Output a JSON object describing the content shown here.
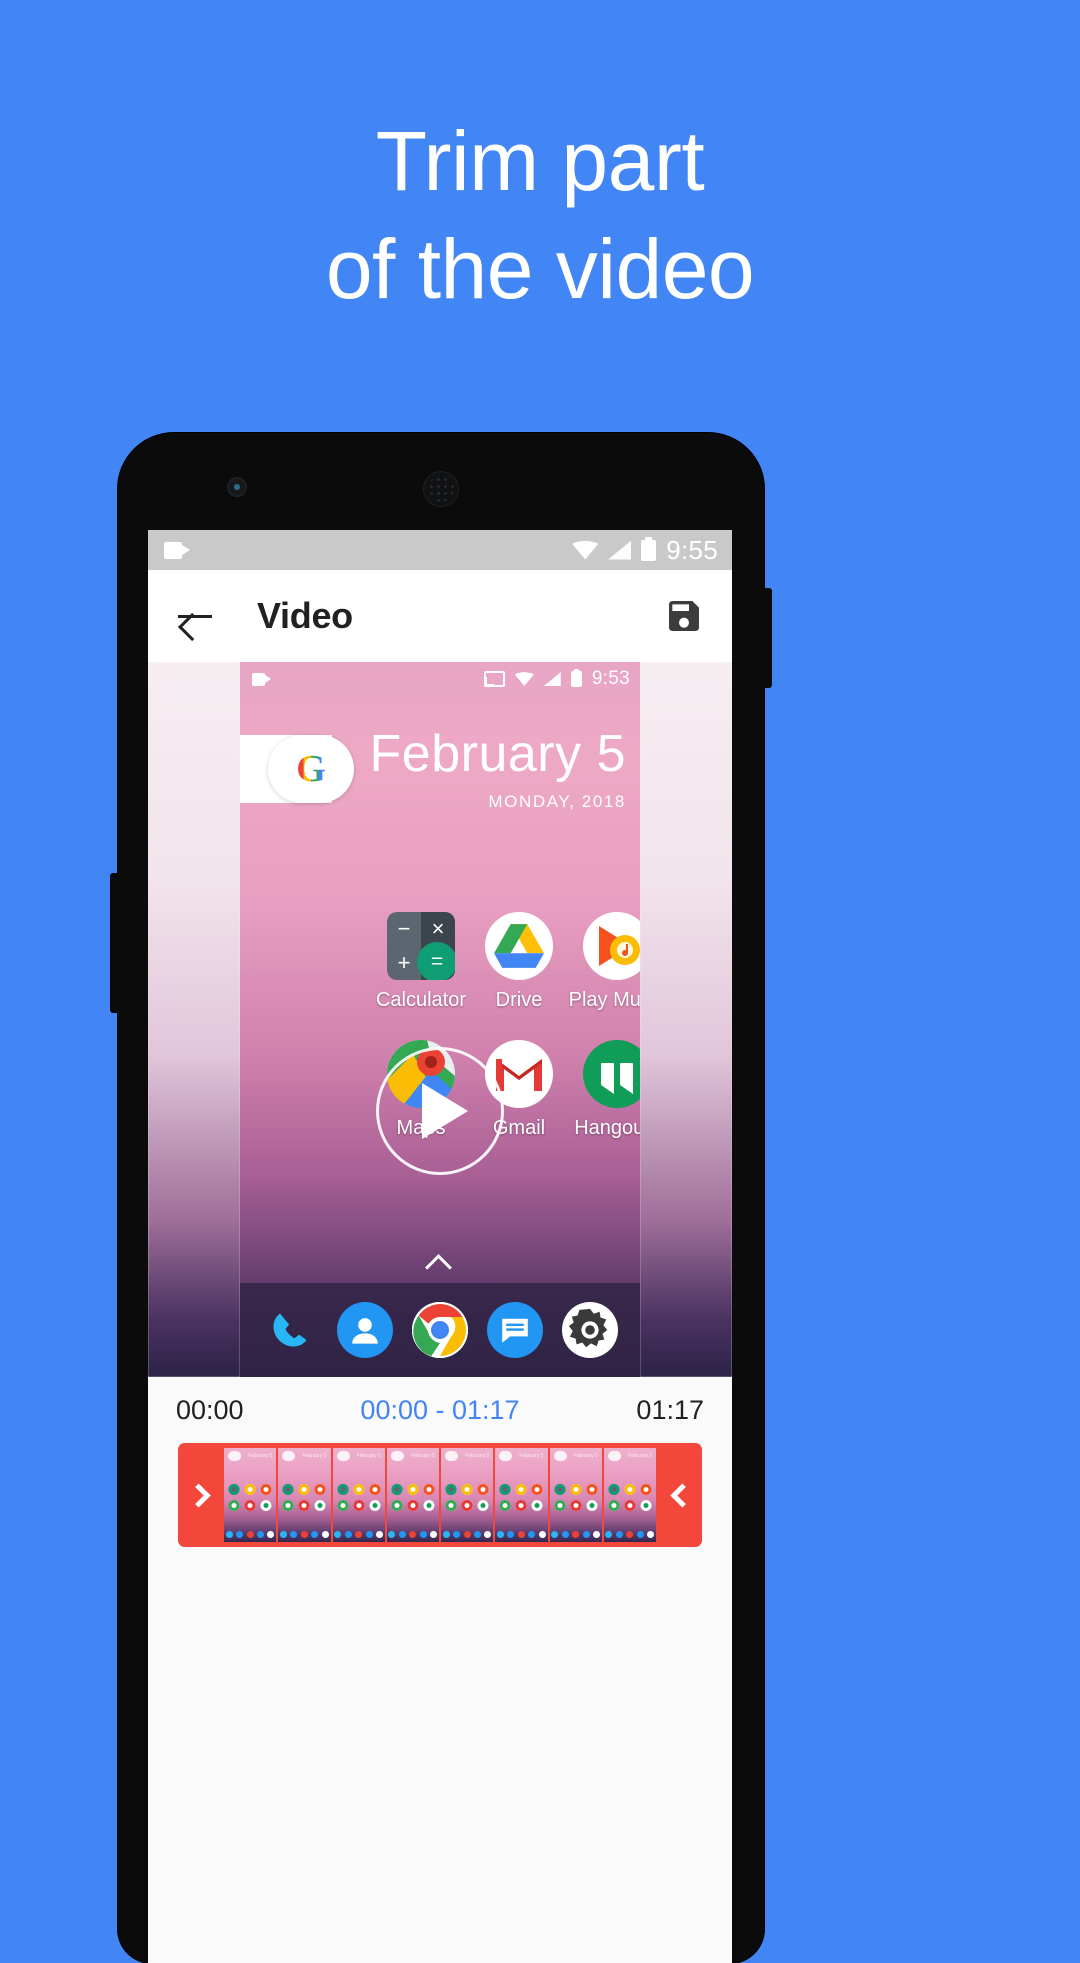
{
  "headline": {
    "line1": "Trim part",
    "line2": "of the video"
  },
  "theme": {
    "background": "#4285f4",
    "accent": "#4285f4",
    "trim_red": "#f4473b"
  },
  "status_bar": {
    "icons": [
      "videocam-icon",
      "wifi-icon",
      "signal-icon",
      "battery-icon"
    ],
    "time": "9:55"
  },
  "app_bar": {
    "back_label": "back-arrow-icon",
    "title": "Video",
    "save_label": "save-icon"
  },
  "video": {
    "inner_status": {
      "time": "9:53",
      "icons": [
        "videocam-icon",
        "cast-icon",
        "wifi-icon",
        "signal-icon",
        "battery-icon"
      ]
    },
    "widget": {
      "logo": "G"
    },
    "date": {
      "day": "February 5",
      "sub": "MONDAY, 2018"
    },
    "apps": [
      {
        "name": "Calculator",
        "label": "Calculator"
      },
      {
        "name": "Drive",
        "label": "Drive"
      },
      {
        "name": "Play Music",
        "label": "Play Music"
      },
      {
        "name": "Maps",
        "label": "Maps"
      },
      {
        "name": "Gmail",
        "label": "Gmail"
      },
      {
        "name": "Hangouts",
        "label": "Hangouts"
      }
    ],
    "dock": [
      "phone-icon",
      "contacts-icon",
      "chrome-icon",
      "messages-icon",
      "settings-icon"
    ],
    "play_button": "play-icon"
  },
  "trim": {
    "start": "00:00",
    "range": "00:00 - 01:17",
    "end": "01:17",
    "handle_left": "chevron-right-icon",
    "handle_right": "chevron-left-icon"
  }
}
